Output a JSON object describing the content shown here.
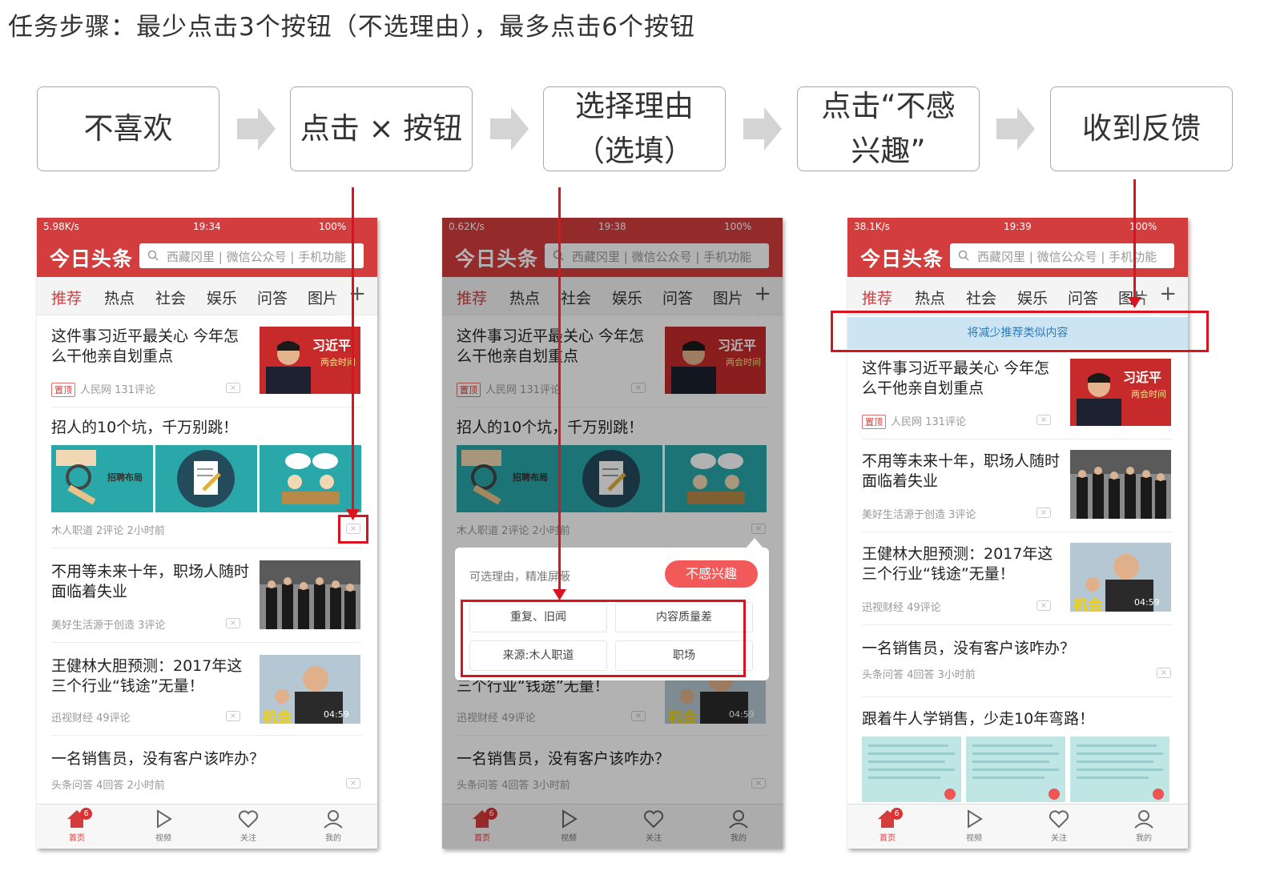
{
  "heading": "任务步骤：最少点击3个按钮（不选理由），最多点击6个按钮",
  "steps": {
    "s1": "不喜欢",
    "s2": "点击 × 按钮",
    "s3a": "选择理由",
    "s3b": "（选填）",
    "s4a": "点击“不感",
    "s4b": "兴趣”",
    "s5": "收到反馈"
  },
  "app": {
    "logo": "今日头条",
    "search_placeholder": "西藏冈里 | 微信公众号 | 手机功能",
    "tabs": [
      "推荐",
      "热点",
      "社会",
      "娱乐",
      "问答",
      "图片"
    ],
    "tab_plus": "+",
    "nav": [
      "首页",
      "视频",
      "关注",
      "我的"
    ],
    "nav_badge": "6"
  },
  "status": {
    "p1": {
      "left": "5.98K/s",
      "time": "19:34",
      "right": "100%"
    },
    "p2": {
      "left": "0.62K/s",
      "time": "19:38",
      "right": "100%"
    },
    "p3": {
      "left": "38.1K/s",
      "time": "19:39",
      "right": "100%"
    }
  },
  "articles": {
    "xi": {
      "title": "这件事习近平最关心 今年怎么干他亲自划重点",
      "hot": "置顶",
      "source": "人民网 131评论",
      "thumb_text": "习近平",
      "thumb_sub": "两会时间"
    },
    "zhaoren": {
      "title": "招人的10个坑，千万别跳！",
      "meta": "木人职道 2评论 2小时前",
      "img_label": "招聘布局"
    },
    "buyong": {
      "title": "不用等未来十年，职场人随时面临着失业",
      "meta": "美好生活源于创造 3评论"
    },
    "wang": {
      "title": "王健林大胆预测：2017年这三个行业“钱途”无量！",
      "meta": "迅视财经 49评论",
      "duration": "04:59",
      "overlay_text": "机会"
    },
    "xiaoshou": {
      "title": "一名销售员，没有客户该咋办？",
      "meta_p1": "头条问答 4回答 2小时前",
      "meta_p3": "头条问答 4回答 3小时前"
    },
    "genzhe": {
      "title": "跟着牛人学销售，少走10年弯路！"
    }
  },
  "popup": {
    "hint": "可选理由，精准屏蔽",
    "button": "不感兴趣",
    "reasons": [
      "重复、旧闻",
      "内容质量差",
      "来源:木人职道",
      "职场"
    ]
  },
  "notice": "将减少推荐类似内容",
  "colors": {
    "brand": "#d43d3d",
    "annotation": "#d9131f",
    "notice_bg": "#cde4f3"
  }
}
